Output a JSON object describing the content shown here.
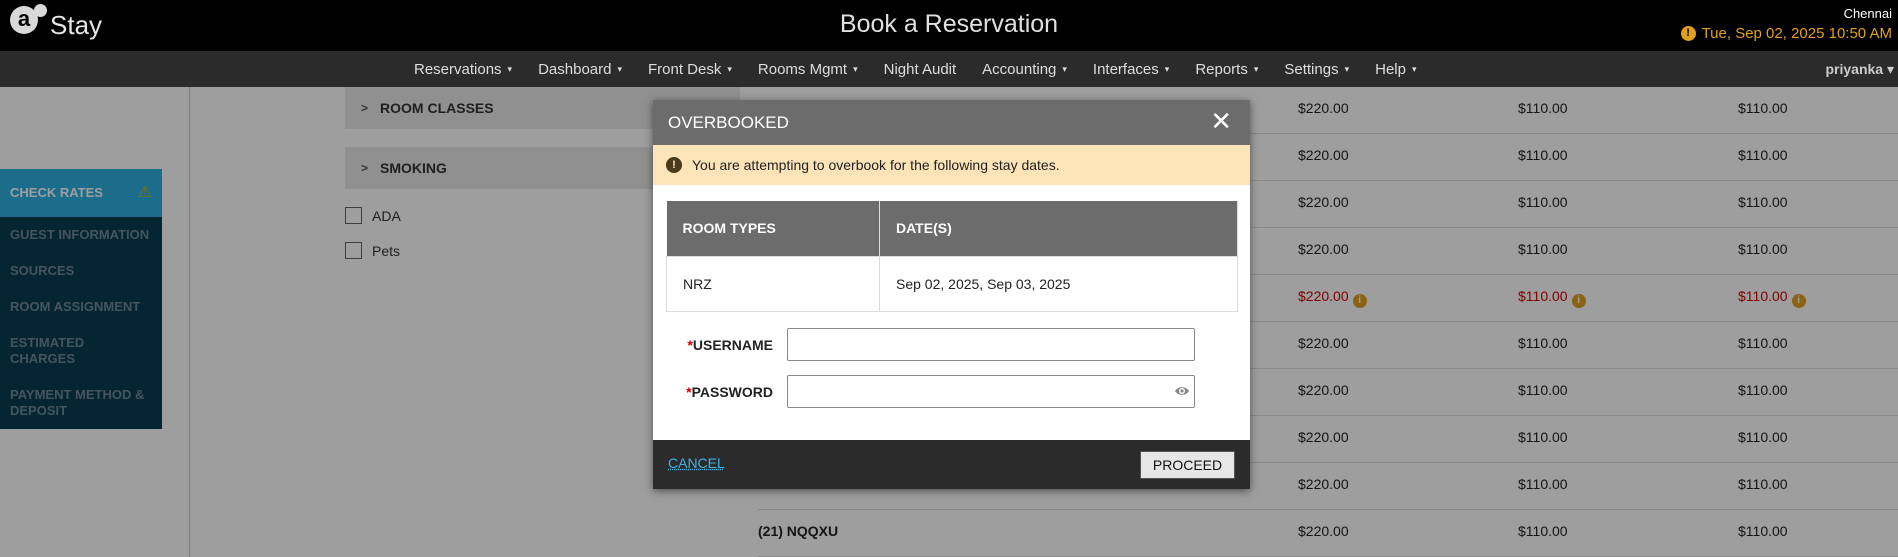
{
  "header": {
    "logo_letter": "a",
    "logo_text": "Stay",
    "title": "Book a Reservation",
    "location": "Chennai",
    "datetime": "Tue, Sep 02, 2025 10:50 AM",
    "warning_glyph": "!"
  },
  "nav": {
    "items": [
      {
        "label": "Reservations",
        "caret": true
      },
      {
        "label": "Dashboard",
        "caret": true
      },
      {
        "label": "Front Desk",
        "caret": true
      },
      {
        "label": "Rooms Mgmt",
        "caret": true
      },
      {
        "label": "Night Audit",
        "caret": false
      },
      {
        "label": "Accounting",
        "caret": true
      },
      {
        "label": "Interfaces",
        "caret": true
      },
      {
        "label": "Reports",
        "caret": true
      },
      {
        "label": "Settings",
        "caret": true
      },
      {
        "label": "Help",
        "caret": true
      }
    ],
    "user": "priyanka",
    "caret_glyph": "▾"
  },
  "sidebar": {
    "items": [
      {
        "label": "CHECK RATES",
        "active": true
      },
      {
        "label": "GUEST INFORMATION"
      },
      {
        "label": "SOURCES"
      },
      {
        "label": "ROOM ASSIGNMENT"
      },
      {
        "label": "ESTIMATED CHARGES"
      },
      {
        "label": "PAYMENT METHOD & DEPOSIT"
      }
    ],
    "warn_glyph": "⚠"
  },
  "filters": {
    "accordions": [
      "ROOM CLASSES",
      "SMOKING"
    ],
    "chevron_glyph": ">",
    "checkboxes": [
      "ADA",
      "Pets"
    ]
  },
  "rates": {
    "rows": [
      {
        "label": "",
        "values": [
          "$220.00",
          "$110.00",
          "$110.00"
        ],
        "overbooked": false
      },
      {
        "label": "",
        "values": [
          "$220.00",
          "$110.00",
          "$110.00"
        ],
        "overbooked": false
      },
      {
        "label": "",
        "values": [
          "$220.00",
          "$110.00",
          "$110.00"
        ],
        "overbooked": false
      },
      {
        "label": "",
        "values": [
          "$220.00",
          "$110.00",
          "$110.00"
        ],
        "overbooked": false
      },
      {
        "label": "",
        "values": [
          "$220.00",
          "$110.00",
          "$110.00"
        ],
        "overbooked": true
      },
      {
        "label": "",
        "values": [
          "$220.00",
          "$110.00",
          "$110.00"
        ],
        "overbooked": false
      },
      {
        "label": "",
        "values": [
          "$220.00",
          "$110.00",
          "$110.00"
        ],
        "overbooked": false
      },
      {
        "label": "",
        "values": [
          "$220.00",
          "$110.00",
          "$110.00"
        ],
        "overbooked": false
      },
      {
        "label": "",
        "values": [
          "$220.00",
          "$110.00",
          "$110.00"
        ],
        "overbooked": false
      },
      {
        "label": "(21)  NQQXU",
        "values": [
          "$220.00",
          "$110.00",
          "$110.00"
        ],
        "overbooked": false
      }
    ],
    "info_glyph": "i"
  },
  "modal": {
    "title": "OVERBOOKED",
    "close_glyph": "✕",
    "alert_glyph": "!",
    "alert_text": "You are attempting to overbook for the following stay dates.",
    "table": {
      "headers": [
        "ROOM TYPES",
        "DATE(S)"
      ],
      "rows": [
        [
          "NRZ",
          "Sep 02, 2025, Sep 03, 2025"
        ]
      ]
    },
    "required_marker": "*",
    "username_label": "USERNAME",
    "username_value": "",
    "password_label": "PASSWORD",
    "password_value": "",
    "cancel_label": "CANCEL",
    "proceed_label": "PROCEED"
  },
  "colors": {
    "header_bg": "#000000",
    "nav_bg": "#2b2b2b",
    "sidebar_bg": "#0b3c52",
    "sidebar_active": "#2eaee0",
    "modal_header": "#6c6c6c",
    "alert_bg": "#fde4b8",
    "overbook_red": "#d00000",
    "warning_amber": "#e0a020",
    "link_blue": "#3db2e6"
  }
}
